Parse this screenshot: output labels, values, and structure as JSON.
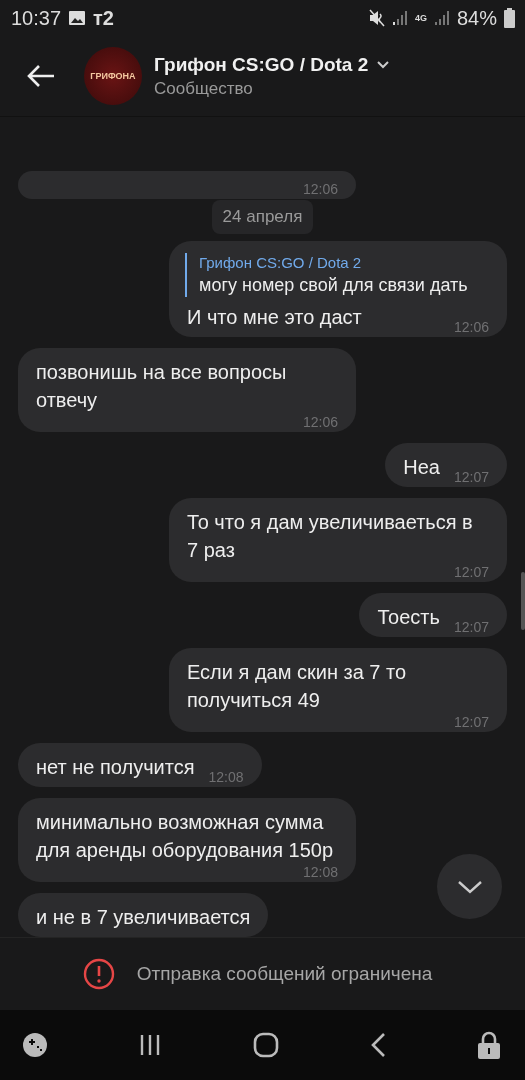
{
  "status_bar": {
    "time": "10:37",
    "carrier": "т2",
    "network": "4G",
    "battery": "84%"
  },
  "header": {
    "title": "Грифон CS:GO / Dota 2",
    "subtitle": "Сообщество",
    "avatar_text": "ГРИФОНА"
  },
  "messages": [
    {
      "kind": "in",
      "time": "12:06"
    },
    {
      "kind": "date",
      "text": "24 апреля"
    },
    {
      "kind": "out",
      "reply": {
        "author": "Грифон CS:GO / Dota 2",
        "text": "могу номер свой для связи дать"
      },
      "text": "И что мне это даст",
      "time": "12:06"
    },
    {
      "kind": "in",
      "text": "позвонишь на все вопросы отвечу",
      "time": "12:06"
    },
    {
      "kind": "out",
      "text": "Неа",
      "time": "12:07"
    },
    {
      "kind": "out",
      "text": "То что я дам увеличиваеться в 7 раз",
      "time": "12:07"
    },
    {
      "kind": "out",
      "text": "Тоесть",
      "time": "12:07"
    },
    {
      "kind": "out",
      "text": "Если я дам скин за 7 то получиться 49",
      "time": "12:07"
    },
    {
      "kind": "in",
      "text": "нет не получится",
      "time": "12:08"
    },
    {
      "kind": "in",
      "text": "минимально возможная сумма для аренды оборудования 150р",
      "time": "12:08"
    },
    {
      "kind": "in",
      "text": "и не в 7 увеличивается"
    }
  ],
  "notice": "Отправка сообщений ограничена"
}
